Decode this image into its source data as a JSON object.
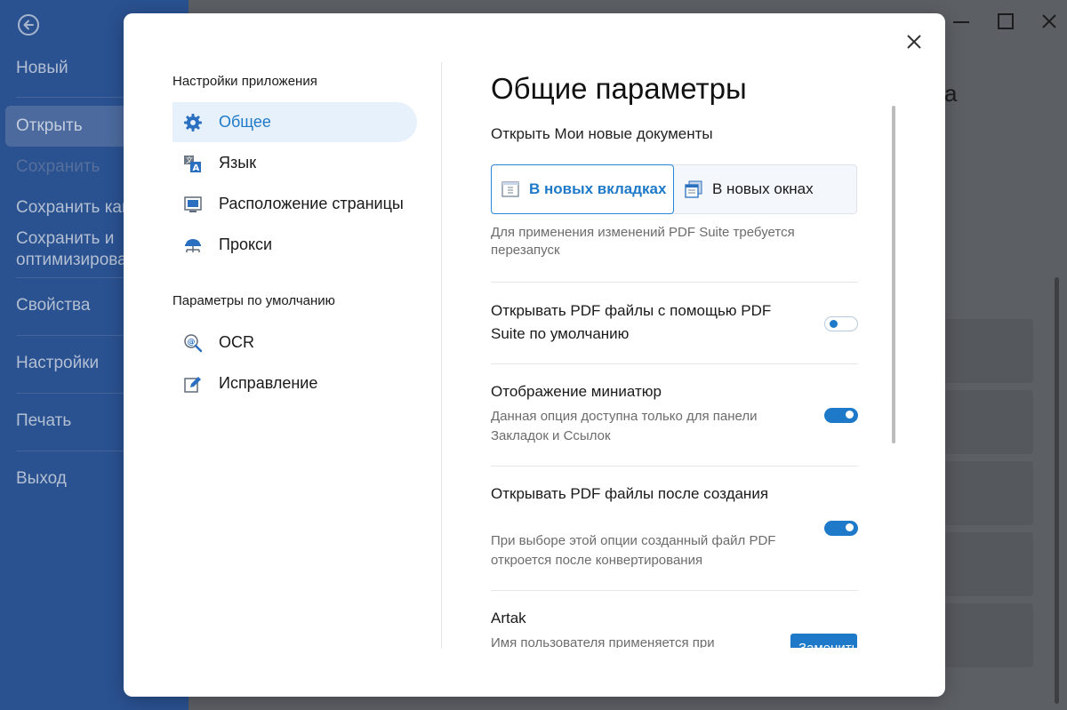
{
  "app": {
    "sidebar": {
      "items": [
        {
          "label": "Новый",
          "state": "normal"
        },
        {
          "label": "Открыть",
          "state": "active"
        },
        {
          "label": "Сохранить",
          "state": "disabled"
        },
        {
          "label": "Сохранить как",
          "state": "normal"
        },
        {
          "label": "Сохранить и оптимизировать",
          "state": "normal"
        },
        {
          "label": "Свойства",
          "state": "normal"
        },
        {
          "label": "Настройки",
          "state": "normal"
        },
        {
          "label": "Печать",
          "state": "normal"
        },
        {
          "label": "Выход",
          "state": "normal"
        }
      ],
      "sohranit_optim_line1": "Сохранить и",
      "sohranit_optim_line2": "оптимизирова",
      "sohranit_kak_visible": "Сохранить как"
    },
    "background_title_fragment": "а"
  },
  "dialog": {
    "nav": {
      "section_app": "Настройки приложения",
      "app_items": [
        {
          "label": "Общее",
          "icon": "gear-icon",
          "active": true
        },
        {
          "label": "Язык",
          "icon": "language-icon",
          "active": false
        },
        {
          "label": "Расположение страницы",
          "icon": "page-layout-icon",
          "active": false
        },
        {
          "label": "Прокси",
          "icon": "proxy-icon",
          "active": false
        }
      ],
      "section_default": "Параметры по умолчанию",
      "default_items": [
        {
          "label": "OCR",
          "icon": "ocr-icon",
          "active": false
        },
        {
          "label": "Исправление",
          "icon": "edit-icon",
          "active": false
        }
      ]
    },
    "content": {
      "heading": "Общие параметры",
      "open_docs_label": "Открыть Мои новые документы",
      "open_mode": {
        "options": [
          {
            "label": "В новых вкладках",
            "selected": true
          },
          {
            "label": "В новых окнах",
            "selected": false
          }
        ]
      },
      "restart_note": "Для применения изменений PDF Suite требуется перезапуск",
      "options": [
        {
          "title": "Открывать PDF файлы с помощью PDF Suite по умолчанию",
          "description": "",
          "enabled": false
        },
        {
          "title": "Отображение миниатюр",
          "description": "Данная опция доступна только для панели Закладок и Ссылок",
          "enabled": true
        },
        {
          "title": "Открывать PDF файлы после создания",
          "description": "При выборе этой опции созданный файл PDF откроется после конвертирования",
          "enabled": true
        }
      ],
      "user": {
        "name": "Artak",
        "description": "Имя пользователя применяется при",
        "button_label": "Заменить"
      }
    }
  },
  "colors": {
    "accent": "#1e7ac9",
    "sidebar_bg": "#2a5190",
    "nav_active_bg": "#e7f1fb"
  }
}
